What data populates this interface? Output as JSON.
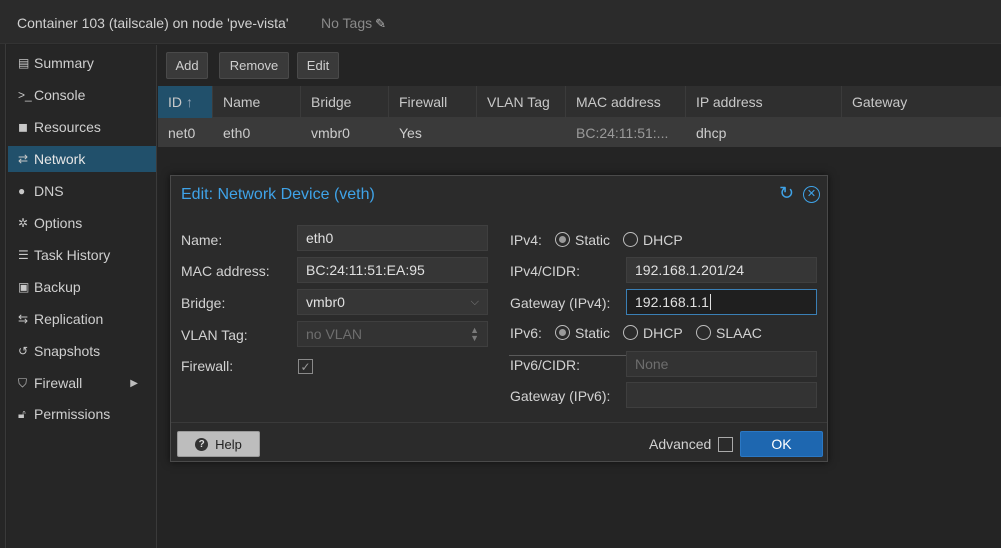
{
  "header": {
    "title": "Container 103 (tailscale) on node 'pve-vista'",
    "tags": "No Tags"
  },
  "sidebar": {
    "items": [
      {
        "label": "Summary",
        "icon": "book-icon"
      },
      {
        "label": "Console",
        "icon": "terminal-icon"
      },
      {
        "label": "Resources",
        "icon": "cube-icon"
      },
      {
        "label": "Network",
        "icon": "exchange-icon"
      },
      {
        "label": "DNS",
        "icon": "globe-icon"
      },
      {
        "label": "Options",
        "icon": "gear-icon"
      },
      {
        "label": "Task History",
        "icon": "list-icon"
      },
      {
        "label": "Backup",
        "icon": "floppy-icon"
      },
      {
        "label": "Replication",
        "icon": "retweet-icon"
      },
      {
        "label": "Snapshots",
        "icon": "history-icon"
      },
      {
        "label": "Firewall",
        "icon": "shield-icon"
      },
      {
        "label": "Permissions",
        "icon": "unlock-icon"
      }
    ]
  },
  "toolbar": {
    "add": "Add",
    "remove": "Remove",
    "edit": "Edit"
  },
  "grid": {
    "columns": [
      "ID",
      "Name",
      "Bridge",
      "Firewall",
      "VLAN Tag",
      "MAC address",
      "IP address",
      "Gateway"
    ],
    "rows": [
      {
        "id": "net0",
        "name": "eth0",
        "bridge": "vmbr0",
        "firewall": "Yes",
        "vlan": "",
        "mac": "BC:24:11:51:...",
        "ip": "dhcp",
        "gateway": ""
      }
    ]
  },
  "dialog": {
    "title": "Edit: Network Device (veth)",
    "name_label": "Name:",
    "name_value": "eth0",
    "mac_label": "MAC address:",
    "mac_value": "BC:24:11:51:EA:95",
    "bridge_label": "Bridge:",
    "bridge_value": "vmbr0",
    "vlan_label": "VLAN Tag:",
    "vlan_placeholder": "no VLAN",
    "firewall_label": "Firewall:",
    "ipv4_label": "IPv4:",
    "ipv4_static": "Static",
    "ipv4_dhcp": "DHCP",
    "ipv4cidr_label": "IPv4/CIDR:",
    "ipv4cidr_value": "192.168.1.201/24",
    "gw4_label": "Gateway (IPv4):",
    "gw4_value": "192.168.1.1",
    "ipv6_label": "IPv6:",
    "ipv6_static": "Static",
    "ipv6_dhcp": "DHCP",
    "ipv6_slaac": "SLAAC",
    "ipv6cidr_label": "IPv6/CIDR:",
    "ipv6cidr_placeholder": "None",
    "gw6_label": "Gateway (IPv6):",
    "help": "Help",
    "advanced": "Advanced",
    "ok": "OK"
  },
  "colors": {
    "accent": "#3fa3e8",
    "selected": "#21506b",
    "ok_button": "#1e67b0"
  }
}
